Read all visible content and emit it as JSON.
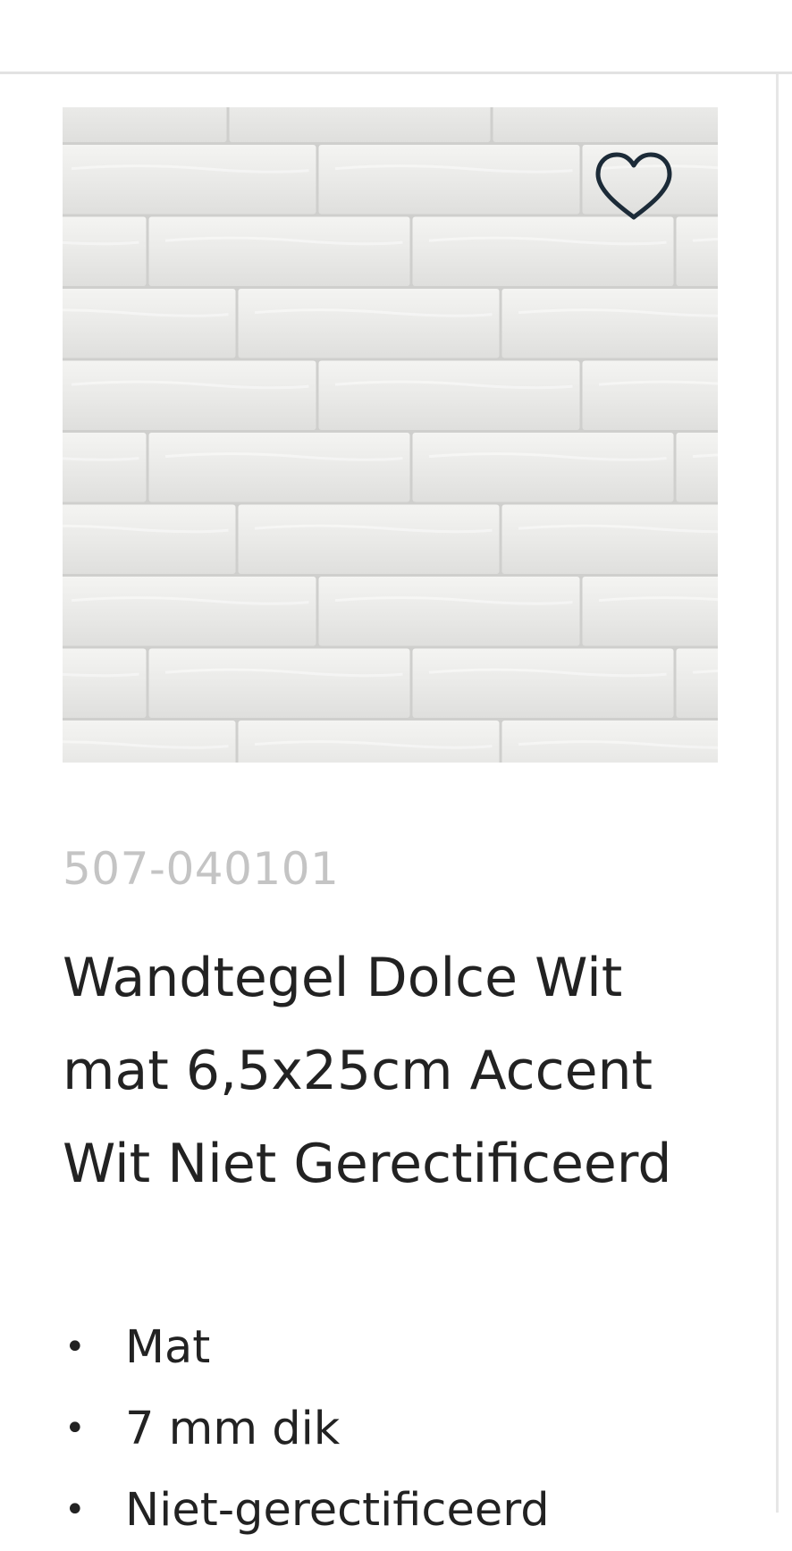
{
  "product": {
    "sku": "507-040101",
    "title": "Wandtegel Dolce Wit mat 6,5x25cm Accent Wit Niet Gerectificeerd",
    "image_icon": "tile-photo",
    "wishlist_icon": "heart-outline-icon",
    "features": [
      {
        "bullet": "•",
        "text": "Mat"
      },
      {
        "bullet": "•",
        "text": "7 mm dik"
      },
      {
        "bullet": "•",
        "text": "Niet-gerectificeerd"
      }
    ]
  },
  "colors": {
    "sku_text": "#c4c4c4",
    "title_text": "#222222",
    "heart_stroke": "#1c2b38",
    "divider": "#e2e2e2"
  }
}
